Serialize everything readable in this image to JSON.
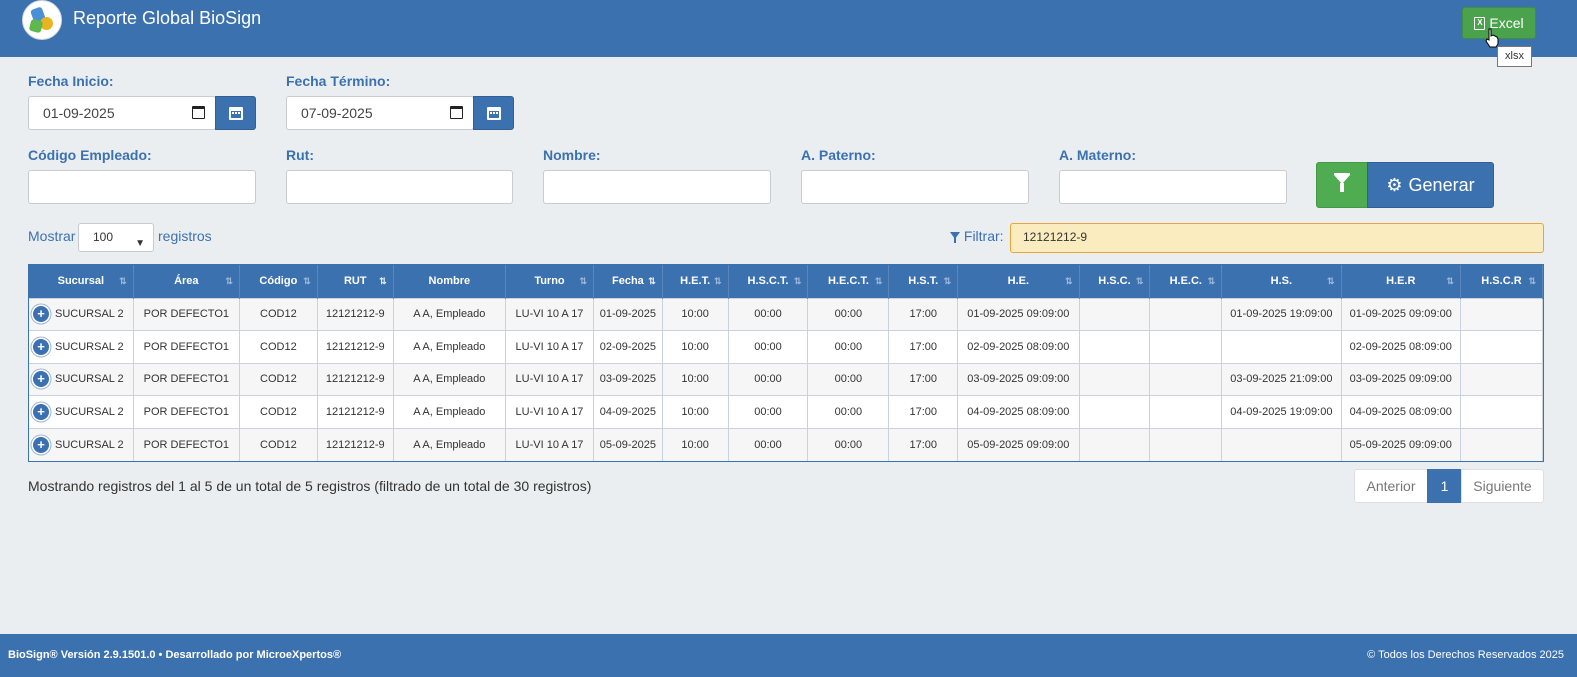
{
  "header": {
    "title": "Reporte Global BioSign",
    "excel_label": "Excel",
    "excel_tooltip": "xlsx"
  },
  "filters": {
    "fecha_inicio_label": "Fecha Inicio:",
    "fecha_inicio_value": "01-09-2025",
    "fecha_termino_label": "Fecha Término:",
    "fecha_termino_value": "07-09-2025",
    "codigo_label": "Código Empleado:",
    "rut_label": "Rut:",
    "nombre_label": "Nombre:",
    "paterno_label": "A. Paterno:",
    "materno_label": "A. Materno:",
    "generar_label": "Generar"
  },
  "table_controls": {
    "mostrar": "Mostrar",
    "page_size": "100",
    "registros": "registros",
    "filtrar_label": "Filtrar:",
    "filtrar_value": "12121212-9"
  },
  "table": {
    "columns": [
      "Sucursal",
      "Área",
      "Código",
      "RUT",
      "Nombre",
      "Turno",
      "Fecha",
      "H.E.T.",
      "H.S.C.T.",
      "H.E.C.T.",
      "H.S.T.",
      "H.E.",
      "H.S.C.",
      "H.E.C.",
      "H.S.",
      "H.E.R",
      "H.S.C.R"
    ],
    "rows": [
      [
        "SUCURSAL 2",
        "POR DEFECTO1",
        "COD12",
        "12121212-9",
        "A A, Empleado",
        "LU-VI 10 A 17",
        "01-09-2025",
        "10:00",
        "00:00",
        "00:00",
        "17:00",
        "01-09-2025 09:09:00",
        "",
        "",
        "01-09-2025 19:09:00",
        "01-09-2025 09:09:00",
        ""
      ],
      [
        "SUCURSAL 2",
        "POR DEFECTO1",
        "COD12",
        "12121212-9",
        "A A, Empleado",
        "LU-VI 10 A 17",
        "02-09-2025",
        "10:00",
        "00:00",
        "00:00",
        "17:00",
        "02-09-2025 08:09:00",
        "",
        "",
        "",
        "02-09-2025 08:09:00",
        ""
      ],
      [
        "SUCURSAL 2",
        "POR DEFECTO1",
        "COD12",
        "12121212-9",
        "A A, Empleado",
        "LU-VI 10 A 17",
        "03-09-2025",
        "10:00",
        "00:00",
        "00:00",
        "17:00",
        "03-09-2025 09:09:00",
        "",
        "",
        "03-09-2025 21:09:00",
        "03-09-2025 09:09:00",
        ""
      ],
      [
        "SUCURSAL 2",
        "POR DEFECTO1",
        "COD12",
        "12121212-9",
        "A A, Empleado",
        "LU-VI 10 A 17",
        "04-09-2025",
        "10:00",
        "00:00",
        "00:00",
        "17:00",
        "04-09-2025 08:09:00",
        "",
        "",
        "04-09-2025 19:09:00",
        "04-09-2025 08:09:00",
        ""
      ],
      [
        "SUCURSAL 2",
        "POR DEFECTO1",
        "COD12",
        "12121212-9",
        "A A, Empleado",
        "LU-VI 10 A 17",
        "05-09-2025",
        "10:00",
        "00:00",
        "00:00",
        "17:00",
        "05-09-2025 09:09:00",
        "",
        "",
        "",
        "05-09-2025 09:09:00",
        ""
      ]
    ]
  },
  "table_info": "Mostrando registros del 1 al 5 de un total de 5 registros (filtrado de un total de 30 registros)",
  "pagination": {
    "prev": "Anterior",
    "current": "1",
    "next": "Siguiente"
  },
  "footer": {
    "left": "BioSign® Versión 2.9.1501.0 • Desarrollado por MicroeXpertos®",
    "right": "© Todos los Derechos Reservados 2025"
  }
}
